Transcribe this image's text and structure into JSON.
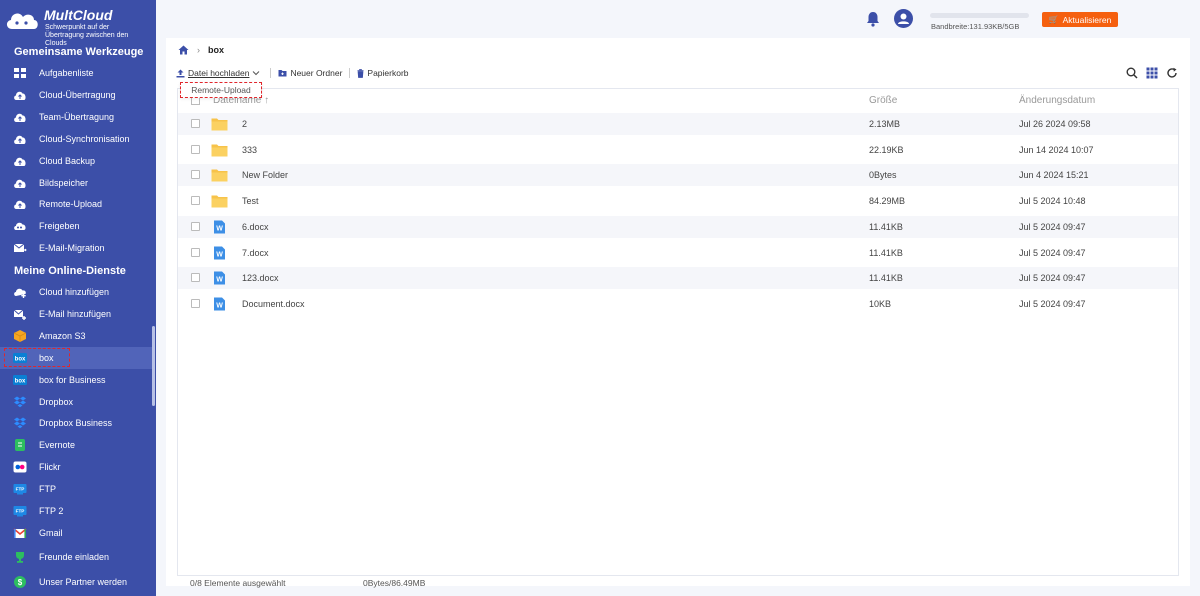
{
  "brand": {
    "name": "MultCloud",
    "tagline": "Schwerpunkt auf der Übertragung zwischen den Clouds"
  },
  "sidebar": {
    "section_tools": "Gemeinsame Werkzeuge",
    "tools": [
      {
        "label": "Aufgabenliste",
        "icon": "grid-icon"
      },
      {
        "label": "Cloud-Übertragung",
        "icon": "cloud-transfer-icon"
      },
      {
        "label": "Team-Übertragung",
        "icon": "team-transfer-icon"
      },
      {
        "label": "Cloud-Synchronisation",
        "icon": "cloud-sync-icon"
      },
      {
        "label": "Cloud Backup",
        "icon": "cloud-backup-icon"
      },
      {
        "label": "Bildspeicher",
        "icon": "image-save-icon"
      },
      {
        "label": "Remote-Upload",
        "icon": "remote-upload-icon"
      },
      {
        "label": "Freigeben",
        "icon": "share-icon"
      },
      {
        "label": "E-Mail-Migration",
        "icon": "email-migration-icon"
      }
    ],
    "section_services": "Meine Online-Dienste",
    "services": [
      {
        "label": "Cloud hinzufügen",
        "icon": "add-cloud-icon"
      },
      {
        "label": "E-Mail hinzufügen",
        "icon": "add-email-icon"
      },
      {
        "label": "Amazon S3",
        "icon": "amazon-s3-icon"
      },
      {
        "label": "box",
        "icon": "box-icon"
      },
      {
        "label": "box for Business",
        "icon": "box-business-icon"
      },
      {
        "label": "Dropbox",
        "icon": "dropbox-icon"
      },
      {
        "label": "Dropbox Business",
        "icon": "dropbox-business-icon"
      },
      {
        "label": "Evernote",
        "icon": "evernote-icon"
      },
      {
        "label": "Flickr",
        "icon": "flickr-icon"
      },
      {
        "label": "FTP",
        "icon": "ftp-icon"
      },
      {
        "label": "FTP 2",
        "icon": "ftp-icon"
      },
      {
        "label": "Gmail",
        "icon": "gmail-icon"
      }
    ],
    "bottom": [
      {
        "label": "Freunde einladen",
        "icon": "trophy-icon"
      },
      {
        "label": "Unser Partner werden",
        "icon": "dollar-icon"
      }
    ]
  },
  "header": {
    "bandwidth": "Bandbreite:131.93KB/5GB",
    "bandwidth_fraction": 0.0,
    "upgrade_label": "Aktualisieren"
  },
  "breadcrumb": {
    "current": "box"
  },
  "toolbar": {
    "upload_label": "Datei hochladen",
    "new_folder_label": "Neuer Ordner",
    "trash_label": "Papierkorb",
    "dropdown_item": "Remote-Upload"
  },
  "table": {
    "col_name": "Dateiname ↑",
    "col_size": "Größe",
    "col_date": "Änderungsdatum",
    "rows": [
      {
        "name": "2",
        "size": "2.13MB",
        "date": "Jul 26 2024 09:58",
        "type": "folder"
      },
      {
        "name": "333",
        "size": "22.19KB",
        "date": "Jun 14 2024 10:07",
        "type": "folder"
      },
      {
        "name": "New Folder",
        "size": "0Bytes",
        "date": "Jun 4 2024 15:21",
        "type": "folder"
      },
      {
        "name": "Test",
        "size": "84.29MB",
        "date": "Jul 5 2024 10:48",
        "type": "folder"
      },
      {
        "name": "6.docx",
        "size": "11.41KB",
        "date": "Jul 5 2024 09:47",
        "type": "docx"
      },
      {
        "name": "7.docx",
        "size": "11.41KB",
        "date": "Jul 5 2024 09:47",
        "type": "docx"
      },
      {
        "name": "123.docx",
        "size": "11.41KB",
        "date": "Jul 5 2024 09:47",
        "type": "docx"
      },
      {
        "name": "Document.docx",
        "size": "10KB",
        "date": "Jul 5 2024 09:47",
        "type": "docx"
      }
    ]
  },
  "footer": {
    "selected": "0/8 Elemente ausgewählt",
    "used": "0Bytes/86.49MB"
  },
  "colors": {
    "sidebar": "#3c4fa8",
    "accent_orange": "#f5600f",
    "highlight_red": "#e0262b",
    "folder": "#f7c34a",
    "docx": "#3d8fe6"
  }
}
